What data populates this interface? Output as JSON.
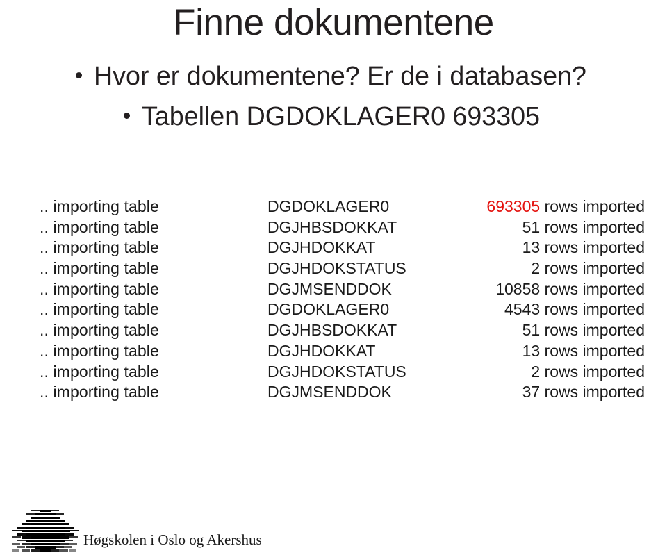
{
  "slide": {
    "title": "Finne dokumentene",
    "bullets": [
      {
        "text": "Hvor er dokumentene? Er de i databasen?"
      },
      {
        "text": "Tabellen DGDOKLAGER0 693305"
      }
    ]
  },
  "import_log": {
    "prefix": ".. importing table",
    "suffix": "rows imported",
    "rows": [
      {
        "prefix": ".. importing table",
        "table": "DGDOKLAGER0",
        "count": "693305",
        "suffix": "rows imported",
        "highlight": true
      },
      {
        "prefix": ".. importing table",
        "table": "DGJHBSDOKKAT",
        "count": "51",
        "suffix": "rows imported",
        "highlight": false
      },
      {
        "prefix": ".. importing table",
        "table": "DGJHDOKKAT",
        "count": "13",
        "suffix": "rows imported",
        "highlight": false
      },
      {
        "prefix": ".. importing table",
        "table": "DGJHDOKSTATUS",
        "count": "2",
        "suffix": "rows imported",
        "highlight": false
      },
      {
        "prefix": ".. importing table",
        "table": "DGJMSENDDOK",
        "count": "10858",
        "suffix": "rows imported",
        "highlight": false
      },
      {
        "prefix": ".. importing table",
        "table": "DGDOKLAGER0",
        "count": "4543",
        "suffix": "rows imported",
        "highlight": false
      },
      {
        "prefix": ".. importing table",
        "table": "DGJHBSDOKKAT",
        "count": "51",
        "suffix": "rows imported",
        "highlight": false
      },
      {
        "prefix": ".. importing table",
        "table": "DGJHDOKKAT",
        "count": "13",
        "suffix": "rows imported",
        "highlight": false
      },
      {
        "prefix": ".. importing table",
        "table": "DGJHDOKSTATUS",
        "count": "2",
        "suffix": "rows imported",
        "highlight": false
      },
      {
        "prefix": ".. importing table",
        "table": "DGJMSENDDOK",
        "count": "37",
        "suffix": "rows imported",
        "highlight": false
      }
    ]
  },
  "footer": {
    "institution": "Høgskolen i Oslo og Akershus",
    "logo_name": "hioa-logo-icon"
  },
  "colors": {
    "text": "#1a1a1a",
    "title": "#231f20",
    "highlight": "#e4120e",
    "background": "#ffffff"
  }
}
